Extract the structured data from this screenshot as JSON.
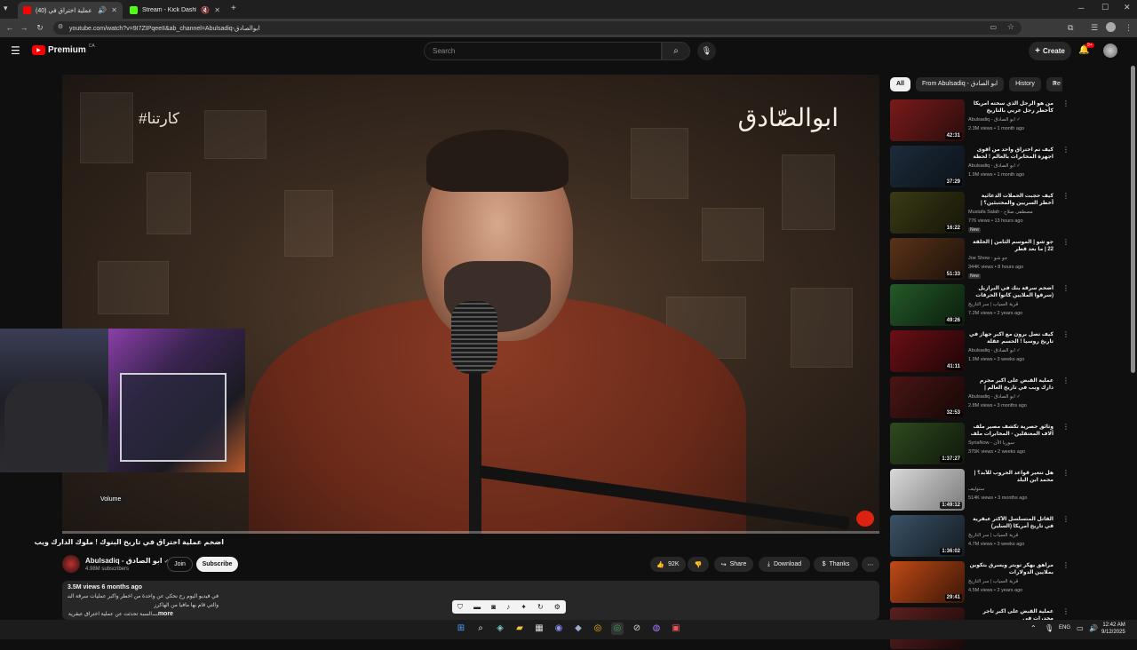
{
  "browser": {
    "tabs": [
      {
        "title": "(40) اضخم عملية اختراق في",
        "favicon_color": "#ff0000",
        "active": true
      },
      {
        "title": "Stream - Kick Dashboard",
        "favicon_color": "#53fc18",
        "active": false
      }
    ],
    "url": "youtube.com/watch?v=9I7ZIPqeeII&ab_channel=Abulsadiq-ابوالصادق"
  },
  "header": {
    "logo": "Premium",
    "region": "CA",
    "search_placeholder": "Search",
    "create_label": "Create",
    "notifications_badge": "9+"
  },
  "video": {
    "overlay_logo": "ابوالصّادق",
    "overlay_hashtag": "#كارتنا",
    "progress": 0.0,
    "volume_tooltip": "Volume",
    "title": "اضخم عملية اختراق في تاريخ البنوك ! ملوك الدارك ويب",
    "channel_name": "Abulsadiq - ابو الصادق",
    "subscribers": "4.98M subscribers",
    "join_label": "Join",
    "subscribe_label": "Subscribe",
    "likes": "92K",
    "share_label": "Share",
    "download_label": "Download",
    "thanks_label": "Thanks"
  },
  "description": {
    "meta": "3.5M views  6 months ago",
    "line1": "في فيديو اليوم رح نحكي عن واحدة من اخطر واكبر عمليات سرقة البنوك",
    "line2": "والتي قام بها مافيا من الهاكرز",
    "line3": "...السبة تحدثت عن عملية اختراق عبقرية",
    "more_label": "...more"
  },
  "chips": [
    {
      "label": "All",
      "active": true
    },
    {
      "label": "From Abulsadiq - ابو الصادق",
      "active": false
    },
    {
      "label": "History",
      "active": false
    },
    {
      "label": "Re",
      "active": false
    }
  ],
  "recommendations": [
    {
      "title": "من هو الرجل الذي سخته امريكا كأخطر رجل عربي بالتاريخ الحديث",
      "channel": "Abulsadiq - ابو الصادق ✓",
      "meta": "2.3M views • 1 month ago",
      "duration": "42:31",
      "thumb": [
        "#7a1a1a",
        "#2a0c0c"
      ],
      "new": ""
    },
    {
      "title": "كيف تم اختراق واحد من اقوى اجهزة المخابرات بالعالم ! لحظة الزرائب !",
      "channel": "Abulsadiq - ابو الصادق ✓",
      "meta": "1.9M views • 1 month ago",
      "duration": "37:29",
      "thumb": [
        "#1d2b3a",
        "#0c1219"
      ],
      "new": ""
    },
    {
      "title": "كيف حجبت الحملات الدعائية أخطر السريين والمختبئين؟ | مشاهد مسلسلة",
      "channel": "Mustafa Salah - مصطفى صلاح",
      "meta": "776 views • 13 hours ago",
      "duration": "16:22",
      "thumb": [
        "#3a3a16",
        "#151507"
      ],
      "new": "New"
    },
    {
      "title": "جو شو | الموسم الثامن | الحلقة 22 | ما بعد قطر",
      "channel": "Joe Show - جو شو",
      "meta": "344K views • 8 hours ago",
      "duration": "51:33",
      "thumb": [
        "#5a3318",
        "#1c110a"
      ],
      "new": "New"
    },
    {
      "title": "أضخم سرقة بنك في البرازيل (سرقوا الملايين كانوا الحرقات إلى لحظة عليهم)",
      "channel": "قرية السياب | سر التاريخ",
      "meta": "7.2M views • 2 years ago",
      "duration": "49:26",
      "thumb": [
        "#245a28",
        "#0b1c0d"
      ],
      "new": ""
    },
    {
      "title": "كيف تصل برون مع اكبر جهاز في تاريخ روسيا ! الحسم عقلة الكيتيكية",
      "channel": "Abulsadiq - ابو الصادق ✓",
      "meta": "1.9M views • 3 weeks ago",
      "duration": "41:11",
      "thumb": [
        "#6b0f15",
        "#1e0507"
      ],
      "new": ""
    },
    {
      "title": "عملية القبض على اكبر مجرم دارك ويب في تاريخ العالم | جبرايل الشتمي",
      "channel": "Abulsadiq - ابو الصادق ✓",
      "meta": "2.8M views • 3 months ago",
      "duration": "32:53",
      "thumb": [
        "#4a1515",
        "#160707"
      ],
      "new": ""
    },
    {
      "title": "وثائق حصرية تكشف مصير ملف آلاف المعتقلين - المخابرات ملف مساعدة الموت",
      "channel": "SyriaNow - سوريا الآن",
      "meta": "375K views • 2 weeks ago",
      "duration": "1:37:27",
      "thumb": [
        "#2f4a1f",
        "#0f180a"
      ],
      "new": ""
    },
    {
      "title": "هل تتغير قواعد الحروب للأبد؟ | محمد ابن البلد",
      "channel": "ستوليف",
      "meta": "514K views • 3 months ago",
      "duration": "1:49:12",
      "thumb": [
        "#d9d9d9",
        "#7a7a7a"
      ],
      "new": ""
    },
    {
      "title": "القاتل المتسلسل الأكثر عبقرية في تاريخ أمريكا (السلير)",
      "channel": "قرية السياب | سر التاريخ",
      "meta": "4.7M views • 3 weeks ago",
      "duration": "1:36:02",
      "thumb": [
        "#3a5266",
        "#131b22"
      ],
      "new": ""
    },
    {
      "title": "مراهق يهكر تويتر ويسرق بتكوين بملايين الدولارات",
      "channel": "قرية السياب | سر التاريخ",
      "meta": "4.5M views • 2 years ago",
      "duration": "29:41",
      "thumb": [
        "#c04a16",
        "#3a1607"
      ],
      "new": ""
    },
    {
      "title": "عملية القبض على اكبر تاجر مخدرات في",
      "channel": "",
      "meta": "",
      "duration": "",
      "thumb": [
        "#5a2020",
        "#1a0808"
      ],
      "new": ""
    }
  ],
  "taskbar": {
    "lang": "ENG",
    "time": "12:42 AM",
    "date": "9/12/2025"
  },
  "colors": {
    "accent": "#ff0000",
    "background": "#0f0f0f"
  }
}
